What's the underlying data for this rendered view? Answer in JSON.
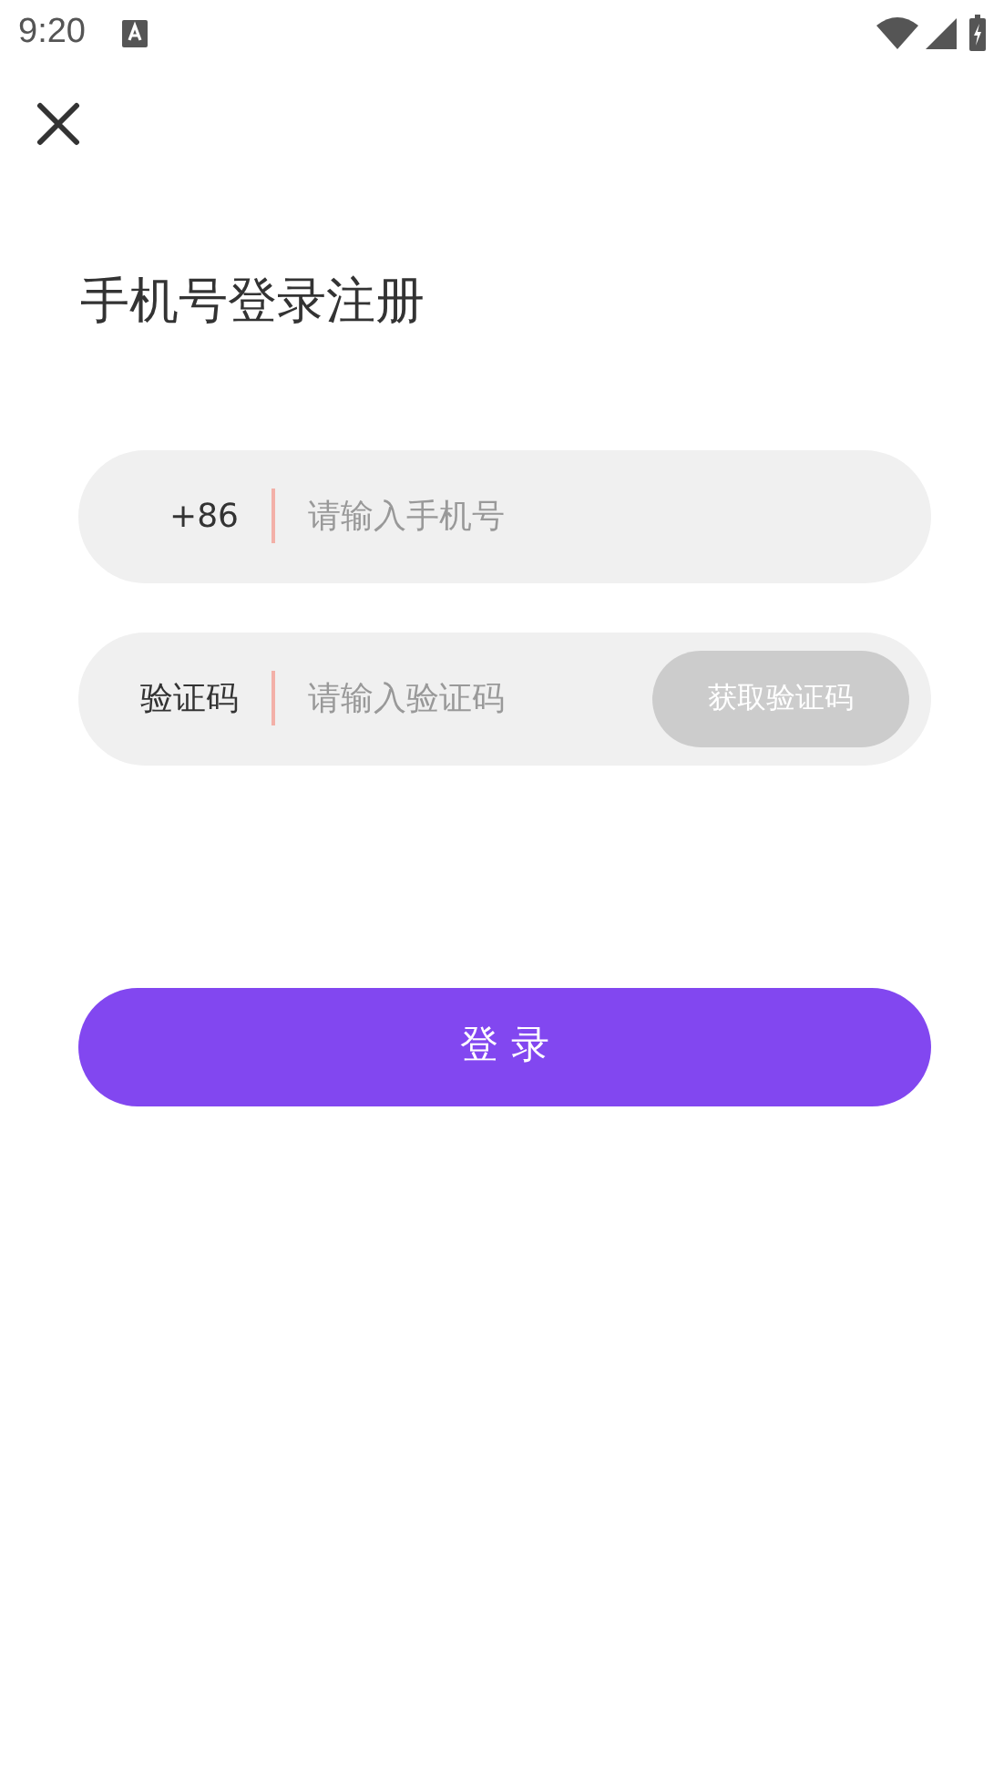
{
  "status_bar": {
    "time": "9:20"
  },
  "title": "手机号登录注册",
  "phone": {
    "prefix": "+86",
    "placeholder": "请输入手机号"
  },
  "code": {
    "label": "验证码",
    "placeholder": "请输入验证码",
    "button": {
      "label": "获取验证码",
      "disabled": true
    }
  },
  "login_button": "登 录"
}
